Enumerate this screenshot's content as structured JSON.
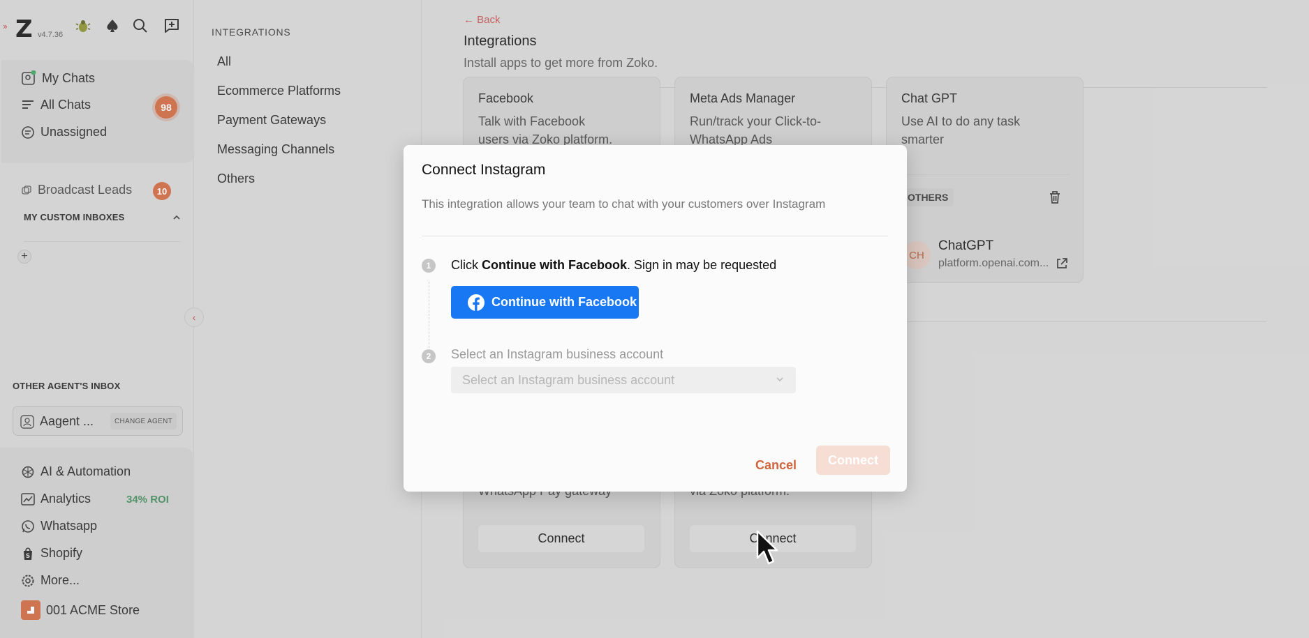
{
  "app": {
    "version": "v4.7.36"
  },
  "sidebar": {
    "my_chats": "My Chats",
    "all_chats": "All Chats",
    "all_chats_count": "98",
    "unassigned": "Unassigned",
    "broadcast_leads": "Broadcast Leads",
    "broadcast_count": "10",
    "custom_inboxes_heading": "MY CUSTOM INBOXES",
    "other_agents_heading": "OTHER AGENT'S INBOX",
    "agent_name": "Aagent ...",
    "change_agent": "CHANGE AGENT",
    "ai_automation": "AI & Automation",
    "analytics": "Analytics",
    "roi": "34% ROI",
    "whatsapp": "Whatsapp",
    "shopify": "Shopify",
    "more": "More...",
    "store": "001 ACME Store"
  },
  "categories": {
    "heading": "INTEGRATIONS",
    "items": [
      "All",
      "Ecommerce Platforms",
      "Payment Gateways",
      "Messaging Channels",
      "Others"
    ]
  },
  "main": {
    "back": "Back",
    "title": "Integrations",
    "subtitle": "Install apps to get more from Zoko.",
    "cards": [
      {
        "title": "Facebook",
        "desc": "Talk with Facebook users via Zoko platform."
      },
      {
        "title": "Meta Ads Manager",
        "desc": "Run/track your Click-to-WhatsApp Ads"
      },
      {
        "title": "Chat GPT",
        "desc": "Use AI to do any task smarter"
      }
    ],
    "others_tag": "OTHERS",
    "chatgpt_initials": "CH",
    "chatgpt_name": "ChatGPT",
    "chatgpt_url": "platform.openai.com...",
    "bottom_cards": [
      {
        "desc": "WhatsApp Pay gateway",
        "button": "Connect"
      },
      {
        "desc": "via Zoko platform.",
        "button": "Connect"
      }
    ]
  },
  "modal": {
    "title": "Connect Instagram",
    "description": "This integration allows your team to chat with your customers over Instagram",
    "step1_num": "1",
    "step1_prefix": "Click ",
    "step1_bold": "Continue with Facebook",
    "step1_suffix": ". Sign in may be requested",
    "fb_button": "Continue with Facebook",
    "step2_num": "2",
    "step2_text": "Select an Instagram business account",
    "select_placeholder": "Select an Instagram business account",
    "cancel": "Cancel",
    "connect": "Connect"
  },
  "colors": {
    "accent": "#d0653d",
    "facebook": "#1877f2",
    "roi_green": "#3f8a5a"
  }
}
